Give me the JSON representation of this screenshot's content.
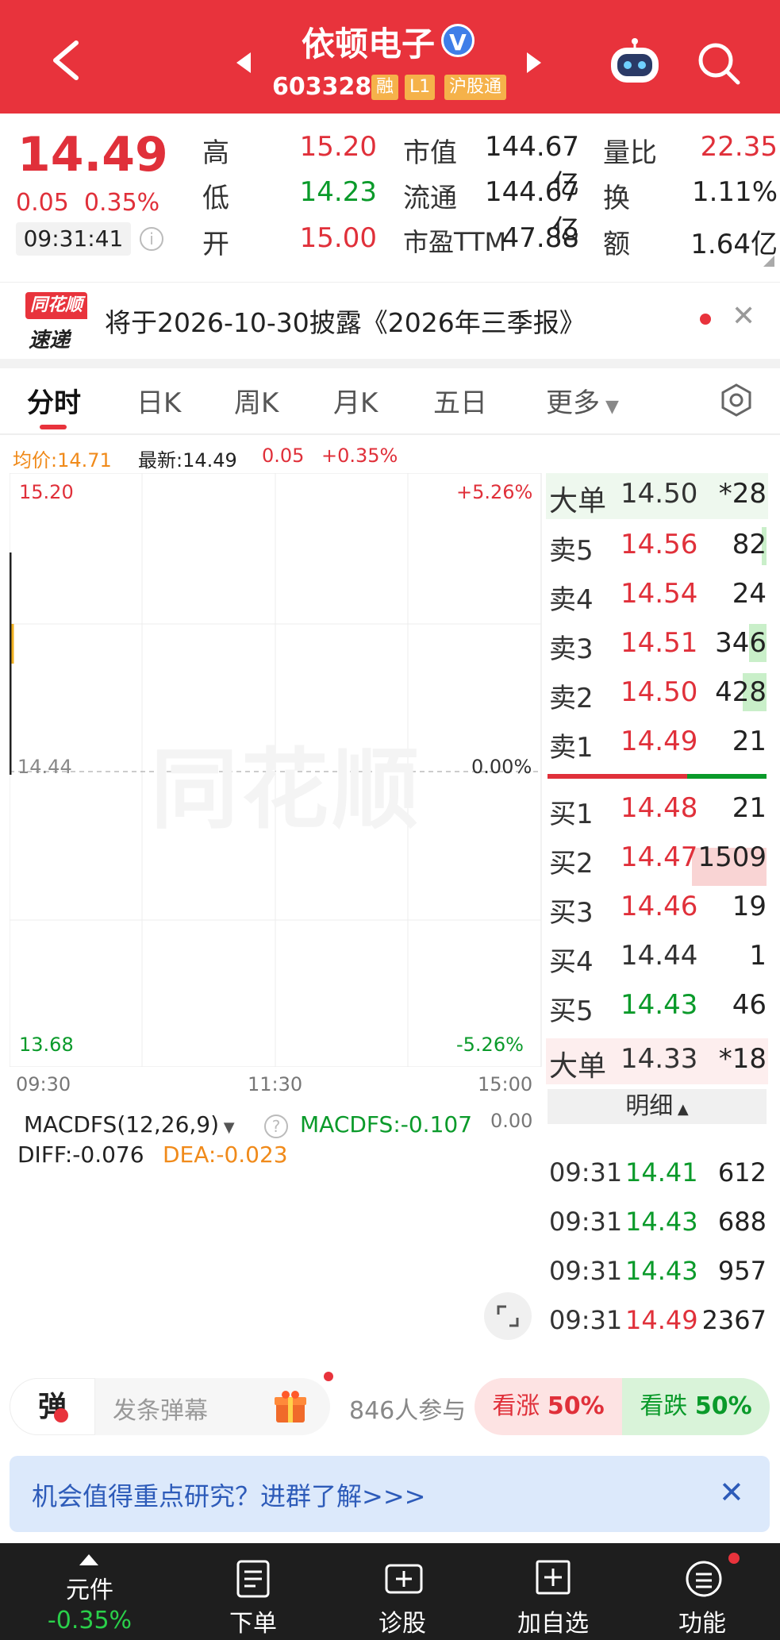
{
  "header": {
    "stock_name": "依顿电子",
    "verified_mark": "V",
    "stock_code": "603328",
    "tags": [
      "融",
      "L1",
      "沪股通"
    ]
  },
  "quote": {
    "price": "14.49",
    "change": "0.05",
    "change_pct": "0.35%",
    "time": "09:31:41",
    "high_label": "高",
    "high": "15.20",
    "low_label": "低",
    "low": "14.23",
    "open_label": "开",
    "open": "15.00",
    "mkt_cap_label": "市值",
    "mkt_cap": "144.67亿",
    "float_cap_label": "流通",
    "float_cap": "144.67亿",
    "pe_label": "市盈TTM",
    "pe": "47.88",
    "vol_ratio_label": "量比",
    "vol_ratio": "22.35",
    "turnover_label": "换",
    "turnover": "1.11%",
    "amount_label": "额",
    "amount": "1.64亿"
  },
  "news": {
    "logo_line1": "同花顺",
    "logo_line2": "速递",
    "text": "将于2026-10-30披露《2026年三季报》",
    "close": "✕"
  },
  "tabs": [
    "分时",
    "日K",
    "周K",
    "月K",
    "五日",
    "更多"
  ],
  "chart": {
    "avg_price": "均价:14.71",
    "latest": "最新:14.49",
    "latest_chg": "0.05",
    "latest_pct": "+0.35%",
    "y_top": "15.20",
    "y_mid": "14.44",
    "y_bot": "13.68",
    "pct_top": "+5.26%",
    "pct_mid": "0.00%",
    "pct_bot": "-5.26%",
    "time_start": "09:30",
    "time_mid": "11:30",
    "time_end": "15:00",
    "watermark": "同花顺",
    "macd_title": "MACDFS(12,26,9)",
    "macd_value": "MACDFS:-0.107",
    "macd_zero": "0.00",
    "diff": "DIFF:-0.076",
    "dea": "DEA:-0.023"
  },
  "order_book": {
    "big_sell": {
      "label": "大单",
      "price": "14.50",
      "vol": "*28"
    },
    "asks": [
      {
        "label": "卖5",
        "price": "14.56",
        "vol": "82"
      },
      {
        "label": "卖4",
        "price": "14.54",
        "vol": "24"
      },
      {
        "label": "卖3",
        "price": "14.51",
        "vol": "346"
      },
      {
        "label": "卖2",
        "price": "14.50",
        "vol": "428"
      },
      {
        "label": "卖1",
        "price": "14.49",
        "vol": "21"
      }
    ],
    "bids": [
      {
        "label": "买1",
        "price": "14.48",
        "vol": "21"
      },
      {
        "label": "买2",
        "price": "14.47",
        "vol": "1509"
      },
      {
        "label": "买3",
        "price": "14.46",
        "vol": "19"
      },
      {
        "label": "买4",
        "price": "14.44",
        "vol": "1"
      },
      {
        "label": "买5",
        "price": "14.43",
        "vol": "46"
      }
    ],
    "big_buy": {
      "label": "大单",
      "price": "14.33",
      "vol": "*18"
    },
    "detail_label": "明细"
  },
  "trades": [
    {
      "time": "09:31",
      "price": "14.41",
      "vol": "612"
    },
    {
      "time": "09:31",
      "price": "14.43",
      "vol": "688"
    },
    {
      "time": "09:31",
      "price": "14.43",
      "vol": "957"
    },
    {
      "time": "09:31",
      "price": "14.49",
      "vol": "2367"
    }
  ],
  "danmu": {
    "icon": "弹",
    "placeholder": "发条弹幕",
    "participants": "846人参与",
    "bull_label": "看涨",
    "bull_pct": "50%",
    "bear_label": "看跌",
    "bear_pct": "50%"
  },
  "banner": {
    "text": "机会值得重点研究？进群了解>>>",
    "close": "✕"
  },
  "bottom_nav": {
    "stock_label": "元件",
    "stock_change": "-0.35%",
    "items": [
      "下单",
      "诊股",
      "加自选",
      "功能"
    ]
  }
}
